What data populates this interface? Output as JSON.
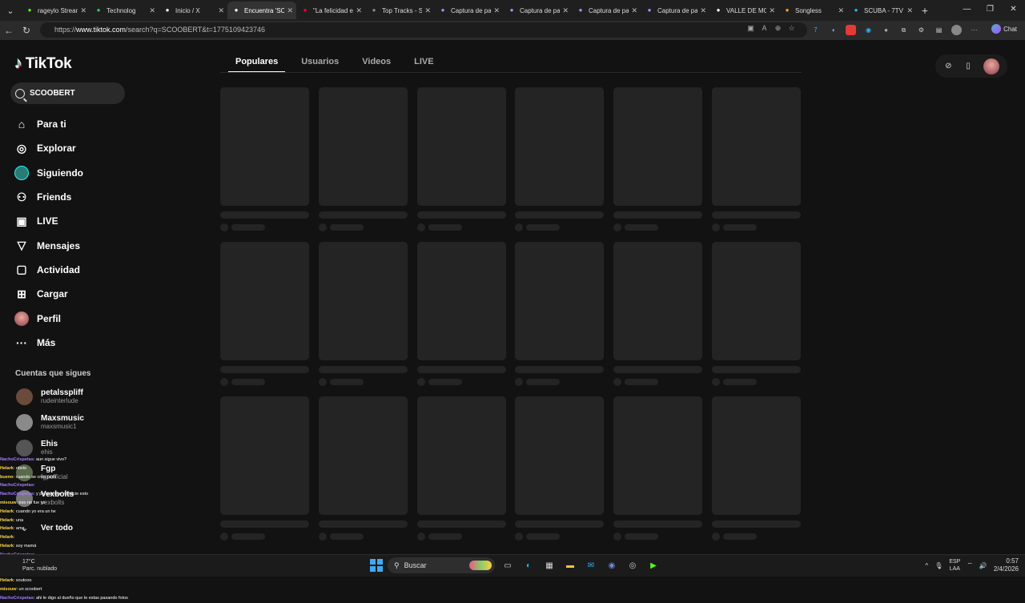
{
  "browser": {
    "tabs": [
      {
        "label": "rageylo Stream",
        "icon": "kick-icon",
        "color": "#53fc18"
      },
      {
        "label": "Technolog",
        "icon": "spotify-icon",
        "color": "#1ed760"
      },
      {
        "label": "Inicio / X",
        "icon": "x-icon",
        "color": "#ffffff"
      },
      {
        "label": "Encuentra 'SCO",
        "icon": "tiktok-icon",
        "color": "#ffffff"
      },
      {
        "label": "\"La felicidad es",
        "icon": "youtube-icon",
        "color": "#ff0033"
      },
      {
        "label": "Top Tracks - Sta",
        "icon": "tab-icon",
        "color": "#888888"
      },
      {
        "label": "Captura de par",
        "icon": "pen-icon",
        "color": "#b48cff"
      },
      {
        "label": "Captura de par",
        "icon": "pen-icon",
        "color": "#b48cff"
      },
      {
        "label": "Captura de par",
        "icon": "pen-icon",
        "color": "#b48cff"
      },
      {
        "label": "Captura de par",
        "icon": "pen-icon",
        "color": "#b48cff"
      },
      {
        "label": "VALLE DE MON",
        "icon": "google-icon",
        "color": "#ffffff"
      },
      {
        "label": "Songless",
        "icon": "songless-icon",
        "color": "#f5a623"
      },
      {
        "label": "SCUBA - 7TV",
        "icon": "7tv-icon",
        "color": "#29b6f6"
      }
    ],
    "active_tab": 3,
    "url_prefix": "https://",
    "url_host": "www.tiktok.com",
    "url_path": "/search?q=SCOOBERT&t=1775109423746",
    "chat_label": "Chat"
  },
  "sidebar": {
    "logo_text": "TikTok",
    "search_value": "SCOOBERT",
    "nav": [
      {
        "label": "Para ti",
        "icon": "home-icon"
      },
      {
        "label": "Explorar",
        "icon": "compass-icon"
      },
      {
        "label": "Siguiendo",
        "icon": "following-avatar-icon"
      },
      {
        "label": "Friends",
        "icon": "friends-icon"
      },
      {
        "label": "LIVE",
        "icon": "live-icon"
      },
      {
        "label": "Mensajes",
        "icon": "messages-icon"
      },
      {
        "label": "Actividad",
        "icon": "activity-icon"
      },
      {
        "label": "Cargar",
        "icon": "upload-icon"
      },
      {
        "label": "Perfil",
        "icon": "profile-avatar-icon"
      },
      {
        "label": "Más",
        "icon": "more-icon"
      }
    ],
    "following_title": "Cuentas que sigues",
    "following": [
      {
        "name": "petalsspliff",
        "handle": "rudeinterlude"
      },
      {
        "name": "Maxsmusic",
        "handle": "maxsmusic1"
      },
      {
        "name": "Ehis",
        "handle": "ehis"
      },
      {
        "name": "Fgp",
        "handle": "fgpofficial"
      },
      {
        "name": "Vexbolts",
        "handle": "vexbolts"
      }
    ],
    "see_all": "Ver todo"
  },
  "search_tabs": [
    "Populares",
    "Usuarios",
    "Videos",
    "LIVE"
  ],
  "active_search_tab": 0,
  "chat_overlay": [
    {
      "user": "NachoCrispetas",
      "msg": "aun sigue vivo?"
    },
    {
      "user": "Helark",
      "msg": "obvio"
    },
    {
      "user": "bueno",
      "msg": "cuando se crea piola"
    },
    {
      "user": "NachoCrispetas",
      "msg": ""
    },
    {
      "user": "NachoCrispetas",
      "msg": "y pensar que yo inicie esto"
    },
    {
      "user": "misouw",
      "msg": "eso no fue yo"
    },
    {
      "user": "Helark",
      "msg": "cuando yo era un tw"
    },
    {
      "user": "Helark",
      "msg": "una"
    },
    {
      "user": "Helark",
      "msg": "ama"
    },
    {
      "user": "Helark",
      "msg": ""
    },
    {
      "user": "Helark",
      "msg": "soy mamá"
    },
    {
      "user": "NachoCrispetas",
      "msg": ""
    },
    {
      "user": "Helark",
      "msg": "el dueño no me deja"
    },
    {
      "user": "NachoCrispetas",
      "msg": "foto o fake"
    },
    {
      "user": "Helark",
      "msg": "soutooo"
    },
    {
      "user": "misouw",
      "msg": "un scoobert"
    },
    {
      "user": "NachoCrispetas",
      "msg": "ahi le digo al dueño que le estas pasando fotos"
    }
  ],
  "taskbar": {
    "weather_temp": "17°C",
    "weather_desc": "Parc. nublado",
    "search_placeholder": "Buscar",
    "lang_top": "ESP",
    "lang_bottom": "LAA",
    "time": "0:57",
    "date": "2/4/2026"
  }
}
